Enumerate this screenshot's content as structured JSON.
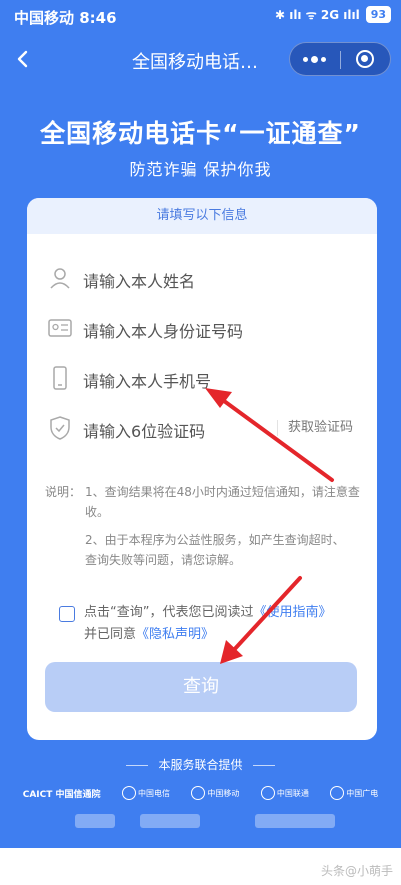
{
  "status_bar": {
    "carrier_time": "中国移动 8:46",
    "indicators": "✱ ılı ᯤ 2G ılıl",
    "battery": "93"
  },
  "nav": {
    "title": "全国移动电话…"
  },
  "hero": {
    "title": "全国移动电话卡“一证通查”",
    "subtitle": "防范诈骗 保护你我"
  },
  "form": {
    "header": "请填写以下信息",
    "name_placeholder": "请输入本人姓名",
    "id_placeholder": "请输入本人身份证号码",
    "phone_placeholder": "请输入本人手机号",
    "code_placeholder": "请输入6位验证码",
    "get_code": "获取验证码"
  },
  "notes": {
    "label": "说明：",
    "note1": "1、查询结果将在48小时内通过短信通知，请注意查收。",
    "note2": "2、由于本程序为公益性服务，如产生查询超时、查询失败等问题，请您谅解。"
  },
  "agreement": {
    "prefix": "点击“查询”，代表您已阅读过",
    "guide_link": "《使用指南》",
    "middle": "并已同意",
    "privacy_link": "《隐私声明》"
  },
  "query_button": "查询",
  "footer": {
    "title": "本服务联合提供",
    "partners": [
      "CAICT 中国信通院",
      "中国电信",
      "中国移动",
      "中国联通",
      "中国广电"
    ]
  },
  "watermark": "头条@小萌手",
  "colors": {
    "background": "#3f7ef0",
    "accent": "#3f7ef0",
    "button_disabled": "#b8cdf6",
    "arrow": "#e4262b"
  }
}
